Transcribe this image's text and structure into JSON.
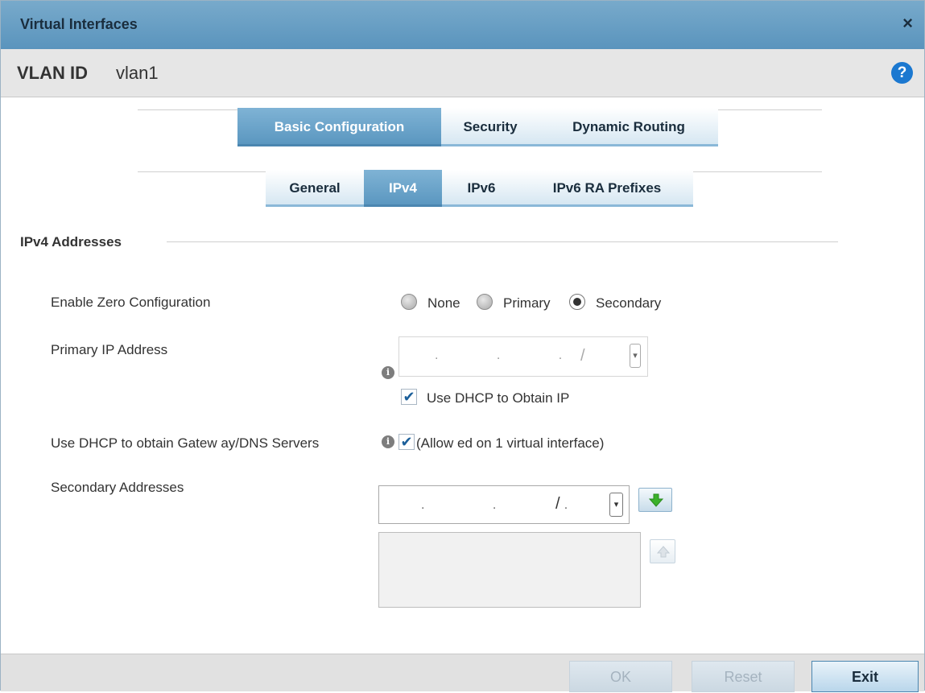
{
  "window": {
    "title": "Virtual Interfaces",
    "close_glyph": "×"
  },
  "header": {
    "label": "VLAN ID",
    "value": "vlan1",
    "help_glyph": "?"
  },
  "tabs": [
    {
      "label": "Basic Configuration",
      "active": true
    },
    {
      "label": "Security",
      "active": false
    },
    {
      "label": "Dynamic Routing",
      "active": false
    }
  ],
  "subtabs": [
    {
      "label": "General",
      "active": false
    },
    {
      "label": "IPv4",
      "active": true
    },
    {
      "label": "IPv6",
      "active": false
    },
    {
      "label": "IPv6 RA Prefixes",
      "active": false
    }
  ],
  "section": {
    "title": "IPv4 Addresses"
  },
  "zero_config": {
    "label": "Enable Zero Configuration",
    "options": [
      "None",
      "Primary",
      "Secondary"
    ],
    "selected": "Secondary"
  },
  "primary_ip": {
    "label": "Primary IP Address",
    "value": "",
    "slash": "/",
    "dots": ". . .",
    "info_glyph": "i"
  },
  "use_dhcp_ip": {
    "label": "Use DHCP to Obtain IP",
    "checked": true
  },
  "use_dhcp_gw": {
    "label": "Use DHCP to obtain Gatew ay/DNS Servers",
    "checkbox_label": "(Allow ed on 1 virtual interface)",
    "checked": true,
    "info_glyph": "i"
  },
  "secondary": {
    "label": "Secondary Addresses",
    "dots": ". . .",
    "slash": "/",
    "add_icon": "arrow-down-green-icon",
    "remove_icon": "arrow-up-gray-icon",
    "items": []
  },
  "footer": {
    "ok": "OK",
    "reset": "Reset",
    "exit": "Exit"
  },
  "colors": {
    "titlebar": "#5a94bd",
    "active_tab": "#5b97c0",
    "help": "#1b78d0",
    "add_arrow": "#3bb12a"
  }
}
